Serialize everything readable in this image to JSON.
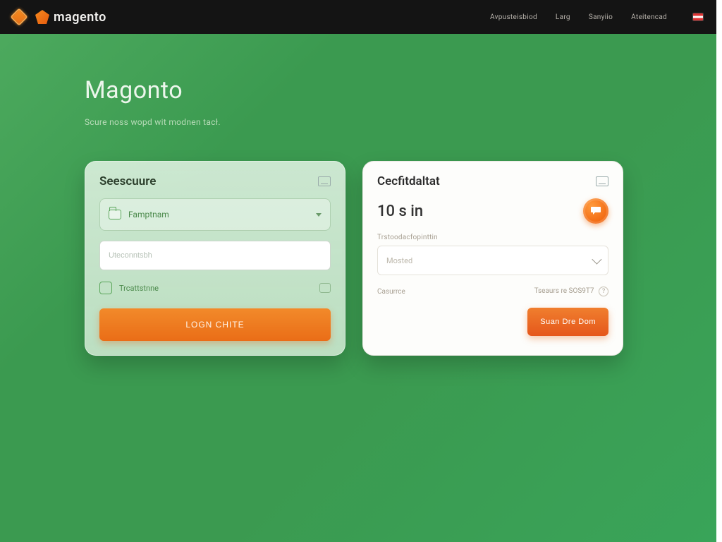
{
  "header": {
    "brand": "magento",
    "nav": [
      "Avpusteisbiod",
      "Larg",
      "Sanyiio",
      "Ateitencad"
    ]
  },
  "hero": {
    "title": "Magonto",
    "subtitle": "Scure noss wopd wit modnen tacł."
  },
  "card_a": {
    "title": "Seescuure",
    "row1_label": "Famptnam",
    "input_placeholder": "Uteconntsbh",
    "check_label": "Trcattstnne",
    "button": "LOGN CHITE"
  },
  "card_b": {
    "title": "Cecfitdaltat",
    "price": "10 s in",
    "tiny_label": "Trstoodacfopinttin",
    "select_placeholder": "Mosted",
    "foot_left": "Casurrce",
    "foot_right": "Tseaurs re SOS9T7",
    "button": "Suan Dre Dom"
  }
}
